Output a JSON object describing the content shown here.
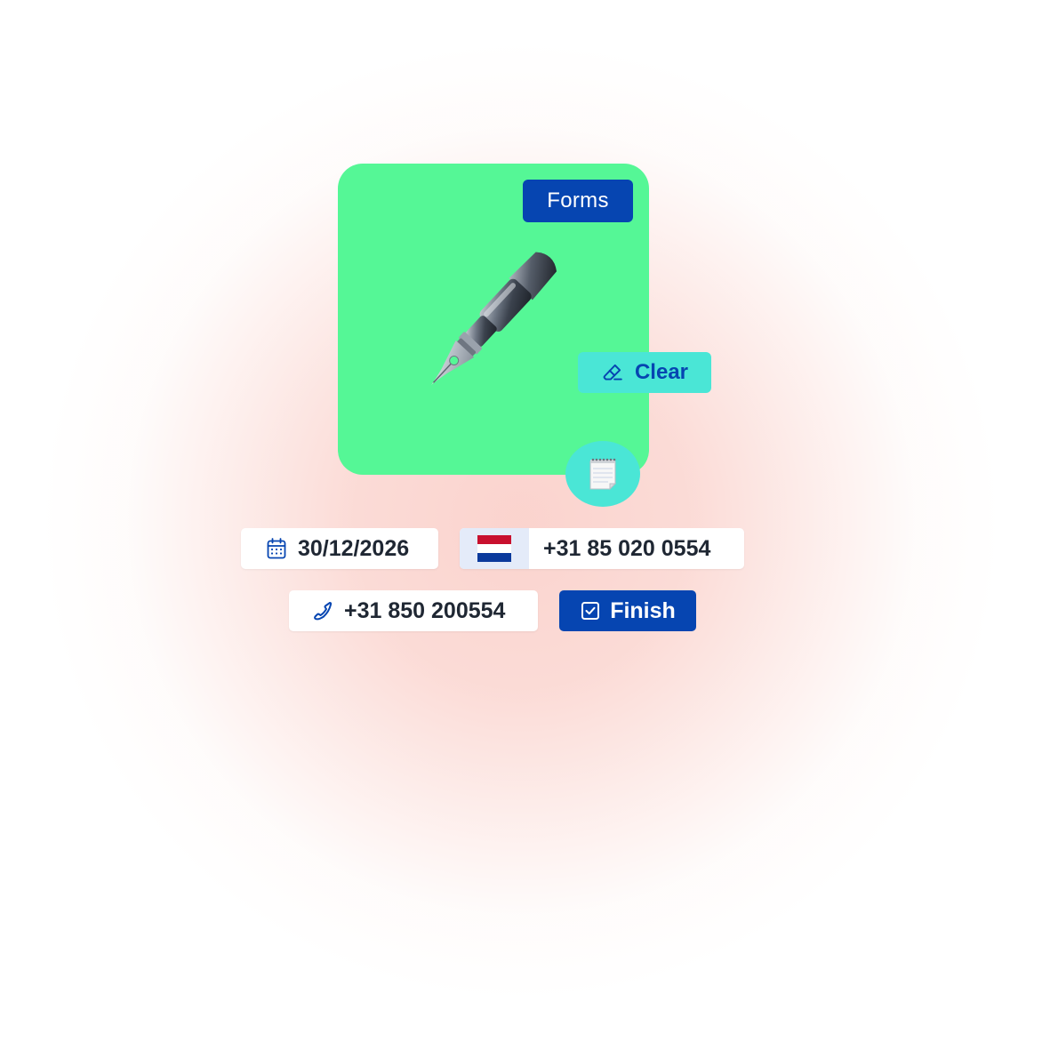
{
  "card": {
    "background": "#55f796",
    "tag_label": "Forms",
    "illustration": "fountain-pen-icon"
  },
  "clear_button": {
    "label": "Clear",
    "icon": "eraser-icon"
  },
  "notepad_button": {
    "icon": "notepad-icon"
  },
  "date_field": {
    "icon": "calendar-icon",
    "value": "30/12/2026"
  },
  "intl_phone_field": {
    "country_flag": "netherlands-flag",
    "value": "+31 85 020 0554"
  },
  "phone_field": {
    "icon": "phone-icon",
    "value": "+31 850 200554"
  },
  "finish_button": {
    "icon": "checkbox-icon",
    "label": "Finish"
  },
  "colors": {
    "brand_blue": "#0645b1",
    "accent_cyan": "#4ae6d6",
    "card_green": "#55f796",
    "text_dark": "#1f2733"
  }
}
